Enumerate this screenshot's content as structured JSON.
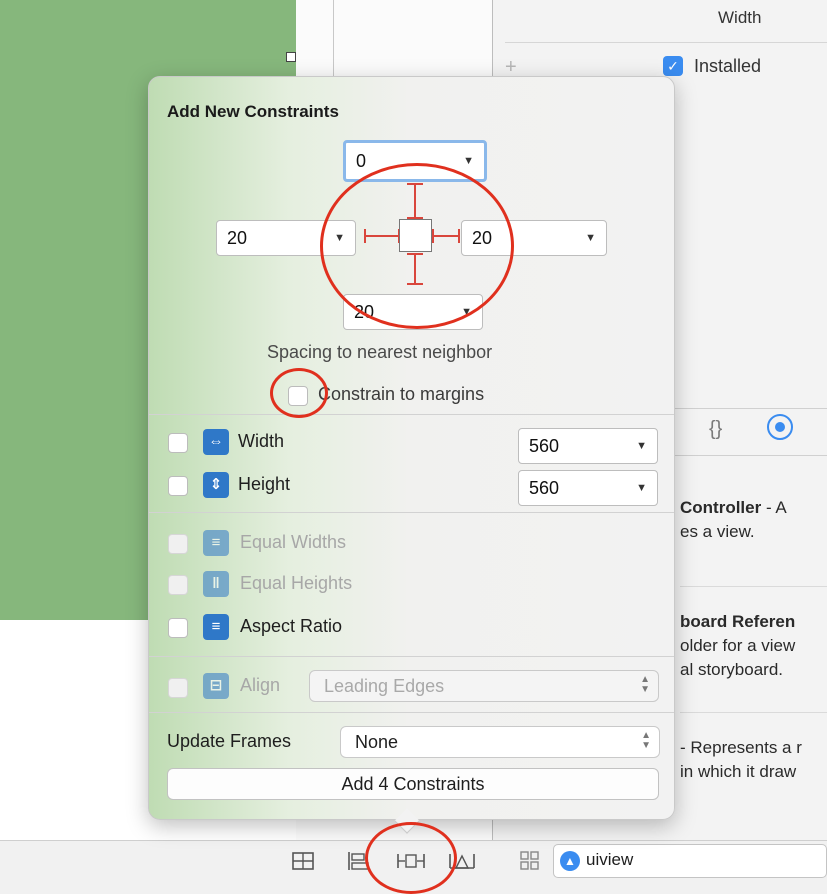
{
  "inspector": {
    "width_label": "Width",
    "plus": "+",
    "installed_check": "✓",
    "installed_label": "Installed",
    "braces_icon": "{}",
    "library": [
      {
        "title": "Controller",
        "rest": " - A",
        "line2": "es a view."
      },
      {
        "title": "board Referen",
        "line2": "older for a view",
        "line3": "al storyboard."
      },
      {
        "line1": "- Represents a r",
        "line2": "in which it draw"
      }
    ]
  },
  "popover": {
    "title": "Add New Constraints",
    "spacing": {
      "top": "0",
      "left": "20",
      "right": "20",
      "bottom": "20",
      "arrow": "▼"
    },
    "spacing_caption": "Spacing to nearest neighbor",
    "constrain_to_margins": {
      "label": "Constrain to margins",
      "checked": false
    },
    "width": {
      "label": "Width",
      "value": "560",
      "checked": false
    },
    "height": {
      "label": "Height",
      "value": "560",
      "checked": false
    },
    "equal_widths": {
      "label": "Equal Widths",
      "enabled": false
    },
    "equal_heights": {
      "label": "Equal Heights",
      "enabled": false
    },
    "aspect_ratio": {
      "label": "Aspect Ratio",
      "checked": false
    },
    "align": {
      "label": "Align",
      "value": "Leading Edges",
      "enabled": false
    },
    "update_frames": {
      "label": "Update Frames",
      "value": "None"
    },
    "add_button": "Add 4 Constraints"
  },
  "bottom_bar": {
    "icons": [
      "embed-in-stack-icon",
      "align-icon",
      "pin-icon",
      "resolve-issues-icon"
    ],
    "filter_text": "uiview"
  },
  "colors": {
    "accent": "#3a8cf0",
    "constraint_red": "#d9463c",
    "annotation_red": "#e0301e",
    "canvas_green": "#86b77c"
  }
}
